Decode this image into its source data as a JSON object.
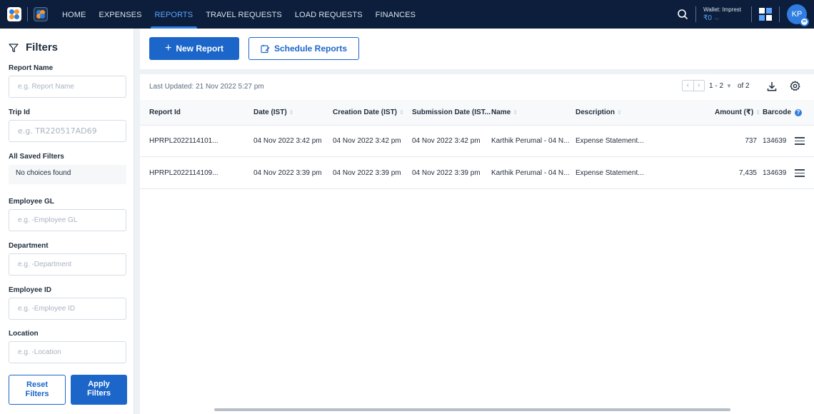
{
  "nav": {
    "links": [
      {
        "label": "HOME",
        "active": false
      },
      {
        "label": "EXPENSES",
        "active": false
      },
      {
        "label": "REPORTS",
        "active": true
      },
      {
        "label": "TRAVEL REQUESTS",
        "active": false
      },
      {
        "label": "LOAD REQUESTS",
        "active": false
      },
      {
        "label": "FINANCES",
        "active": false
      }
    ],
    "wallet_label": "Wallet: Imprest",
    "wallet_value": "₹0",
    "avatar_initials": "KP"
  },
  "sidebar": {
    "title": "Filters",
    "report_name": {
      "label": "Report Name",
      "placeholder": "e.g. Report Name"
    },
    "trip_id": {
      "label": "Trip Id",
      "placeholder": "e.g. TR220517AD69"
    },
    "saved_filters": {
      "label": "All Saved Filters",
      "value": "No choices found"
    },
    "employee_gl": {
      "label": "Employee GL",
      "placeholder": "e.g. -Employee GL"
    },
    "department": {
      "label": "Department",
      "placeholder": "e.g. -Department"
    },
    "employee_id": {
      "label": "Employee ID",
      "placeholder": "e.g. -Employee ID"
    },
    "location": {
      "label": "Location",
      "placeholder": "e.g. -Location"
    },
    "reset_line1": "Reset",
    "reset_line2": "Filters",
    "apply_line1": "Apply",
    "apply_line2": "Filters"
  },
  "actions": {
    "new_report": "New Report",
    "schedule_reports": "Schedule Reports"
  },
  "table": {
    "last_updated": "Last Updated: 21 Nov 2022 5:27 pm",
    "pager_range": "1 - 2",
    "pager_total": "of 2",
    "columns": {
      "report_id": "Report Id",
      "date": "Date (IST)",
      "creation_date": "Creation Date (IST)",
      "submission_date": "Submission Date (IST...",
      "name": "Name",
      "description": "Description",
      "amount": "Amount (₹)",
      "barcode": "Barcode"
    },
    "rows": [
      {
        "report_id": "HPRPL2022114101...",
        "date": "04 Nov 2022 3:42 pm",
        "creation_date": "04 Nov 2022 3:42 pm",
        "submission_date": "04 Nov 2022 3:42 pm",
        "name": "Karthik Perumal - 04 N...",
        "description": "Expense Statement...",
        "amount": "737",
        "barcode": "134639"
      },
      {
        "report_id": "HPRPL2022114109...",
        "date": "04 Nov 2022 3:39 pm",
        "creation_date": "04 Nov 2022 3:39 pm",
        "submission_date": "04 Nov 2022 3:39 pm",
        "name": "Karthik Perumal - 04 N...",
        "description": "Expense Statement...",
        "amount": "7,435",
        "barcode": "134639"
      }
    ]
  },
  "colors": {
    "nav_bg": "#0c1e3b",
    "primary": "#1c66c9",
    "accent": "#2f7de1"
  }
}
